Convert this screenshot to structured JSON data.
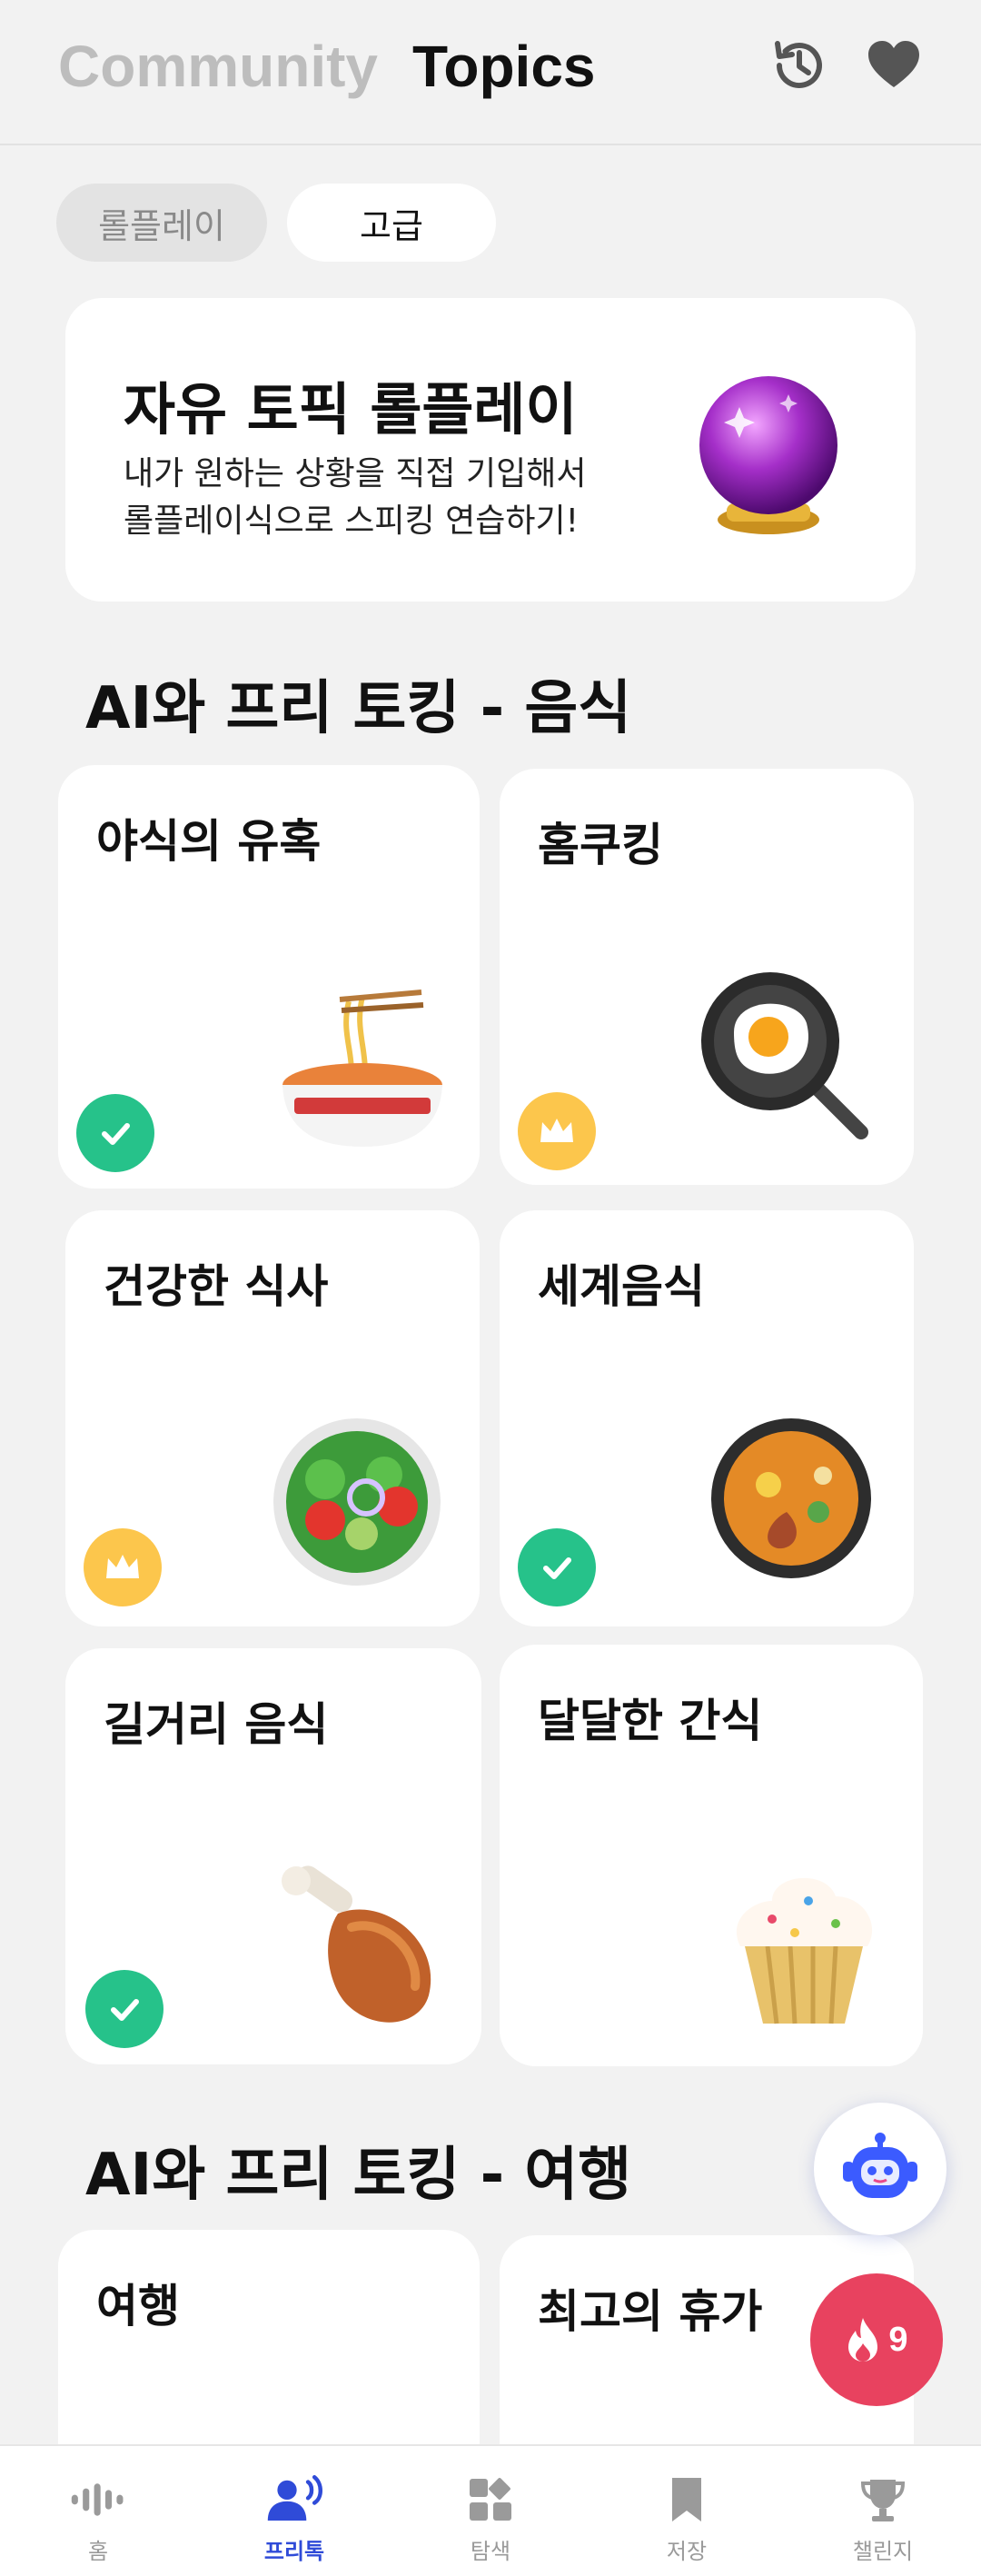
{
  "header": {
    "tabs": [
      {
        "label": "Community",
        "active": false
      },
      {
        "label": "Topics",
        "active": true
      }
    ],
    "icons": [
      "history-icon",
      "heart-icon"
    ]
  },
  "filters": [
    {
      "label": "롤플레이",
      "selected": false
    },
    {
      "label": "고급",
      "selected": true
    }
  ],
  "banner": {
    "title": "자유 토픽 롤플레이",
    "description": "내가 원하는 상황을 직접 기입해서\n롤플레이식으로 스피킹 연습하기!",
    "icon": "crystal-ball-icon"
  },
  "sections": [
    {
      "title": "AI와 프리 토킹 - 음식",
      "cards": [
        {
          "title": "야식의 유혹",
          "icon": "noodle-bowl-icon",
          "badge": "check"
        },
        {
          "title": "홈쿠킹",
          "icon": "frying-pan-egg-icon",
          "badge": "crown"
        },
        {
          "title": "건강한 식사",
          "icon": "salad-icon",
          "badge": "crown"
        },
        {
          "title": "세계음식",
          "icon": "paella-pan-icon",
          "badge": "check"
        },
        {
          "title": "길거리 음식",
          "icon": "chicken-leg-icon",
          "badge": "check"
        },
        {
          "title": "달달한 간식",
          "icon": "cupcake-icon",
          "badge": "none"
        }
      ]
    },
    {
      "title": "AI와 프리 토킹 - 여행",
      "cards": [
        {
          "title": "여행"
        },
        {
          "title": "최고의 휴가"
        }
      ]
    }
  ],
  "floating": {
    "bot_icon": "robot-icon",
    "streak_icon": "flame-icon",
    "streak_count": "9"
  },
  "bottom_nav": [
    {
      "label": "홈",
      "icon": "audio-wave-icon",
      "active": false
    },
    {
      "label": "프리톡",
      "icon": "speaking-person-icon",
      "active": true
    },
    {
      "label": "탐색",
      "icon": "grid-icon",
      "active": false
    },
    {
      "label": "저장",
      "icon": "bookmark-icon",
      "active": false
    },
    {
      "label": "챌린지",
      "icon": "trophy-icon",
      "active": false
    }
  ],
  "colors": {
    "accent": "#2f4bd8",
    "check_badge": "#26c28a",
    "crown_badge": "#fcc64c",
    "streak": "#e8425f"
  }
}
